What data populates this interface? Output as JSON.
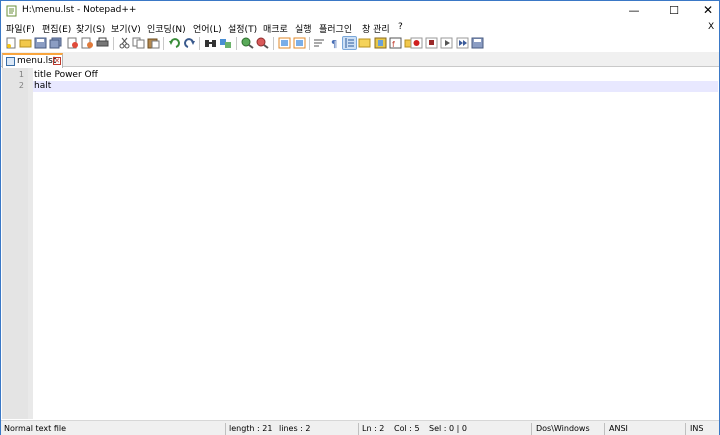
{
  "window": {
    "title": "H:\\menu.lst - Notepad++",
    "minimize": "—",
    "maximize": "☐",
    "close": "✕"
  },
  "menu": {
    "items": [
      "파일(F)",
      "편집(E)",
      "찾기(S)",
      "보기(V)",
      "인코딩(N)",
      "언어(L)",
      "설정(T)",
      "매크로",
      "실행",
      "플러그인",
      "창 관리",
      "?"
    ],
    "close_doc": "X"
  },
  "tab": {
    "label": "menu.lst",
    "close": "✕"
  },
  "editor": {
    "line_numbers": [
      "1",
      "2"
    ],
    "lines": [
      "title Power Off",
      "halt"
    ]
  },
  "status": {
    "file_type": "Normal text file",
    "length": "length : 21",
    "lines": "lines : 2",
    "ln": "Ln : 2",
    "col": "Col : 5",
    "sel": "Sel : 0 | 0",
    "eol": "Dos\\Windows",
    "encoding": "ANSI",
    "mode": "INS"
  },
  "toolbar": {
    "icons": [
      "new-file-icon",
      "open-file-icon",
      "save-icon",
      "save-all-icon",
      "close-icon",
      "close-all-icon",
      "print-icon",
      "cut-icon",
      "copy-icon",
      "paste-icon",
      "undo-icon",
      "redo-icon",
      "find-icon",
      "replace-icon",
      "zoom-in-icon",
      "zoom-out-icon",
      "sync-vertical-icon",
      "sync-horizontal-icon",
      "word-wrap-icon",
      "show-all-chars-icon",
      "indent-guide-icon",
      "user-language-icon",
      "doc-map-icon",
      "function-list-icon",
      "folder-workspace-icon",
      "record-macro-icon",
      "stop-record-icon",
      "play-macro-icon",
      "run-macro-multiple-icon",
      "save-macro-icon"
    ]
  },
  "colors": {
    "tab_accent": "#f9a53d",
    "current_line": "#e8e8ff",
    "window_border": "#3a78c6"
  }
}
